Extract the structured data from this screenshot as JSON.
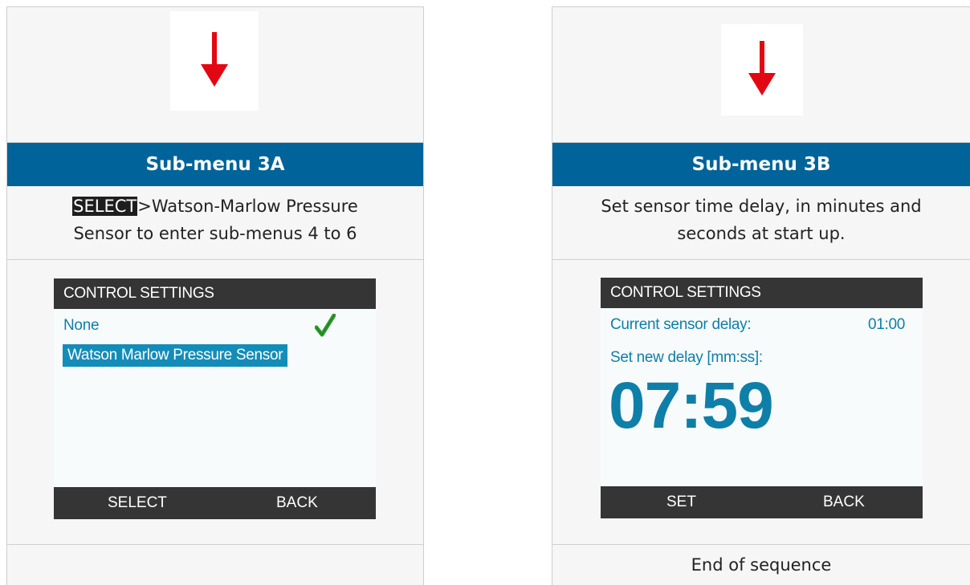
{
  "left": {
    "header": "Sub-menu 3A",
    "desc_key": "SELECT",
    "desc_rest": ">Watson-Marlow Pressure",
    "desc_line2": "Sensor to enter sub-menus 4 to 6",
    "screen": {
      "title": "CONTROL SETTINGS",
      "options": [
        "None",
        "Watson Marlow Pressure Sensor"
      ],
      "selected_option": "Watson Marlow Pressure Sensor",
      "checked_option": "None",
      "soft_keys": [
        "SELECT",
        "BACK"
      ]
    }
  },
  "right": {
    "header": "Sub-menu 3B",
    "desc_line1": "Set sensor time delay, in minutes and",
    "desc_line2": "seconds at start up.",
    "screen": {
      "title": "CONTROL SETTINGS",
      "current_label": "Current sensor delay:",
      "current_value": "01:00",
      "new_label": "Set new delay [mm:ss]:",
      "new_value": "07:59",
      "soft_keys": [
        "SET",
        "BACK"
      ]
    },
    "footer": "End of sequence"
  },
  "colors": {
    "header_bg": "#00639a",
    "arrow": "#e30613",
    "accent": "#0e7fa8",
    "check": "#2e9b2e"
  },
  "icons": {
    "arrow": "arrow-down-icon",
    "check": "checkmark-icon"
  }
}
